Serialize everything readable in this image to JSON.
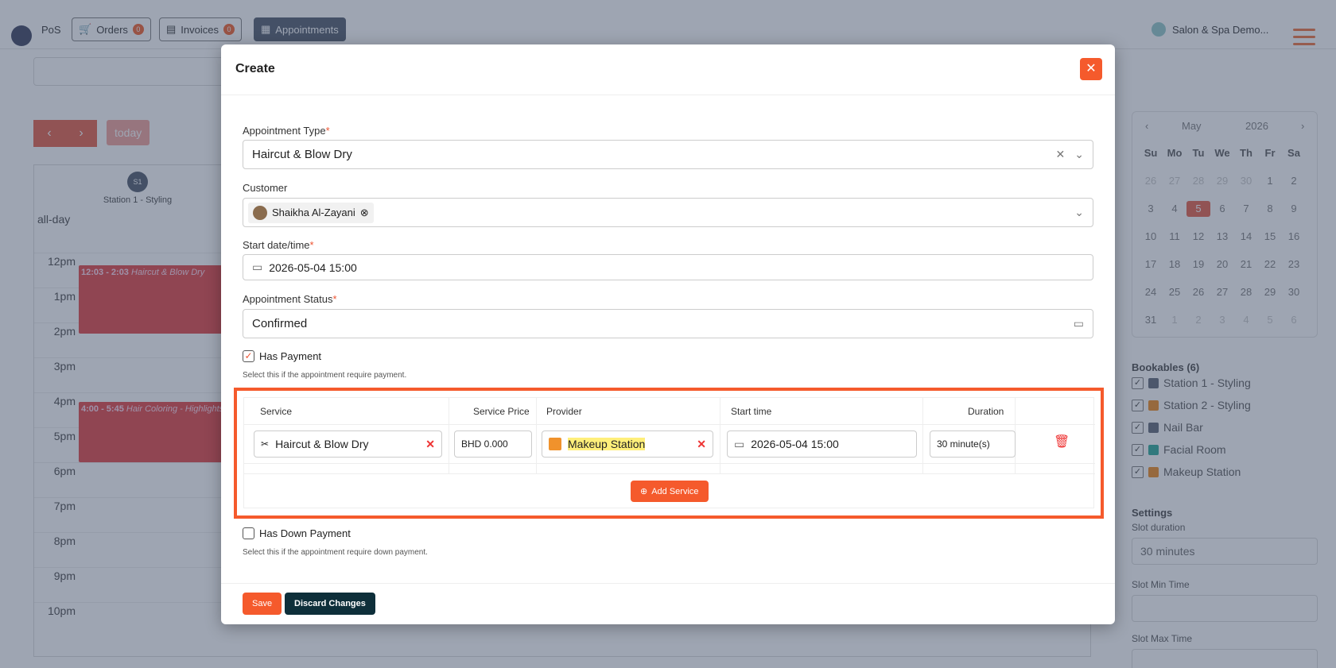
{
  "topbar": {
    "pos": "PoS",
    "orders": "Orders",
    "orders_count": "0",
    "invoices": "Invoices",
    "invoices_count": "0",
    "appointments": "Appointments",
    "user": "Salon & Spa Demo..."
  },
  "calendar": {
    "today": "today",
    "resource_badge": "S1",
    "resource_name": "Station 1 - Styling",
    "allday": "all-day",
    "hours": [
      "12pm",
      "1pm",
      "2pm",
      "3pm",
      "4pm",
      "5pm",
      "6pm",
      "7pm",
      "8pm",
      "9pm",
      "10pm"
    ],
    "events": [
      {
        "time": "12:03 - 2:03",
        "title": "Haircut & Blow Dry"
      },
      {
        "time": "4:00 - 5:45",
        "title": "Hair Coloring - Highlights"
      }
    ]
  },
  "mini_calendar": {
    "month": "May",
    "year": "2026",
    "weekdays": [
      "Su",
      "Mo",
      "Tu",
      "We",
      "Th",
      "Fr",
      "Sa"
    ],
    "days": [
      "26",
      "27",
      "28",
      "29",
      "30",
      "1",
      "2",
      "3",
      "4",
      "5",
      "6",
      "7",
      "8",
      "9",
      "10",
      "11",
      "12",
      "13",
      "14",
      "15",
      "16",
      "17",
      "18",
      "19",
      "20",
      "21",
      "22",
      "23",
      "24",
      "25",
      "26",
      "27",
      "28",
      "29",
      "30",
      "31",
      "1",
      "2",
      "3",
      "4",
      "5",
      "6"
    ],
    "selected": "4"
  },
  "bookables": {
    "title": "Bookables (6)",
    "items": [
      {
        "label": "Station 1 - Styling",
        "color": "#6b7280"
      },
      {
        "label": "Station 2 - Styling",
        "color": "#f0922c"
      },
      {
        "label": "Nail Bar",
        "color": "#6b7280"
      },
      {
        "label": "Facial Room",
        "color": "#3ab09e"
      },
      {
        "label": "Makeup Station",
        "color": "#f0922c"
      }
    ]
  },
  "settings": {
    "title": "Settings",
    "slot_duration_label": "Slot duration",
    "slot_duration_value": "30 minutes",
    "slot_min_label": "Slot Min Time",
    "slot_max_label": "Slot Max Time"
  },
  "modal": {
    "title": "Create",
    "appointment_type_label": "Appointment Type",
    "appointment_type_value": "Haircut & Blow Dry",
    "customer_label": "Customer",
    "customer_value": "Shaikha Al-Zayani",
    "start_label": "Start date/time",
    "start_value": "2026-05-04 15:00",
    "status_label": "Appointment Status",
    "status_value": "Confirmed",
    "has_payment_label": "Has Payment",
    "has_payment_hint": "Select this if the appointment require payment.",
    "services_table": {
      "headers": [
        "Service",
        "Service Price",
        "Provider",
        "Start time",
        "Duration"
      ],
      "row": {
        "service": "Haircut & Blow Dry",
        "price": "BHD 0.000",
        "provider": "Makeup Station",
        "start": "2026-05-04 15:00",
        "duration": "30 minute(s)"
      },
      "add_service": "Add Service"
    },
    "has_down_payment_label": "Has Down Payment",
    "has_down_payment_hint": "Select this if the appointment require down payment.",
    "save": "Save",
    "discard": "Discard Changes"
  }
}
